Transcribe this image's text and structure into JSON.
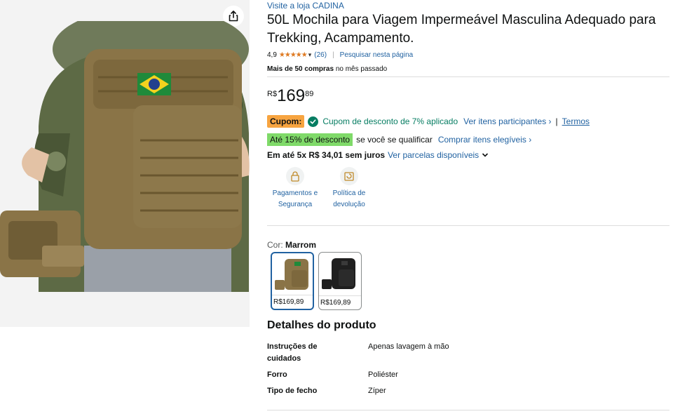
{
  "store_link": "Visite a loja CADINA",
  "title": "50L Mochila para Viagem Impermeável Masculina Adequado para Trekking, Acampamento.",
  "rating": {
    "value": "4,9",
    "stars": "★★★★★",
    "count": "(26)",
    "search_page": "Pesquisar nesta página"
  },
  "bought": {
    "bold": "Mais de 50 compras",
    "rest": "no mês passado"
  },
  "price": {
    "currency": "R$",
    "whole": "169",
    "fraction": "89"
  },
  "coupon": {
    "badge": "Cupom:",
    "text": "Cupom de desconto de 7% aplicado",
    "participants_link": "Ver itens participantes ›",
    "separator": "|",
    "terms_link": "Termos"
  },
  "discount": {
    "badge": "Até 15% de desconto",
    "text": "se você se qualificar",
    "link": "Comprar itens elegíveis ›"
  },
  "installments": {
    "bold": "Em até 5x R$ 34,01 sem juros",
    "link": "Ver parcelas disponíveis"
  },
  "features": [
    {
      "label": "Pagamentos e Segurança",
      "icon": "payment-security-icon"
    },
    {
      "label": "Política de devolução",
      "icon": "return-policy-icon"
    }
  ],
  "color": {
    "label": "Cor:",
    "selected": "Marrom",
    "options": [
      {
        "price": "R$169,89",
        "color": "#8a7447"
      },
      {
        "price": "R$169,89",
        "color": "#1f1f1f"
      }
    ]
  },
  "details": {
    "title": "Detalhes do produto",
    "rows": [
      {
        "label": "Instruções de cuidados",
        "value": "Apenas lavagem à mão"
      },
      {
        "label": "Forro",
        "value": "Poliéster"
      },
      {
        "label": "Tipo de fecho",
        "value": "Zíper"
      }
    ]
  },
  "colors": {
    "link": "#2162a1",
    "coupon_badge": "#f7a440",
    "coupon_text": "#067d62",
    "discount_badge": "#7fda69",
    "stars": "#de7921",
    "backpack": "#8a7447"
  }
}
